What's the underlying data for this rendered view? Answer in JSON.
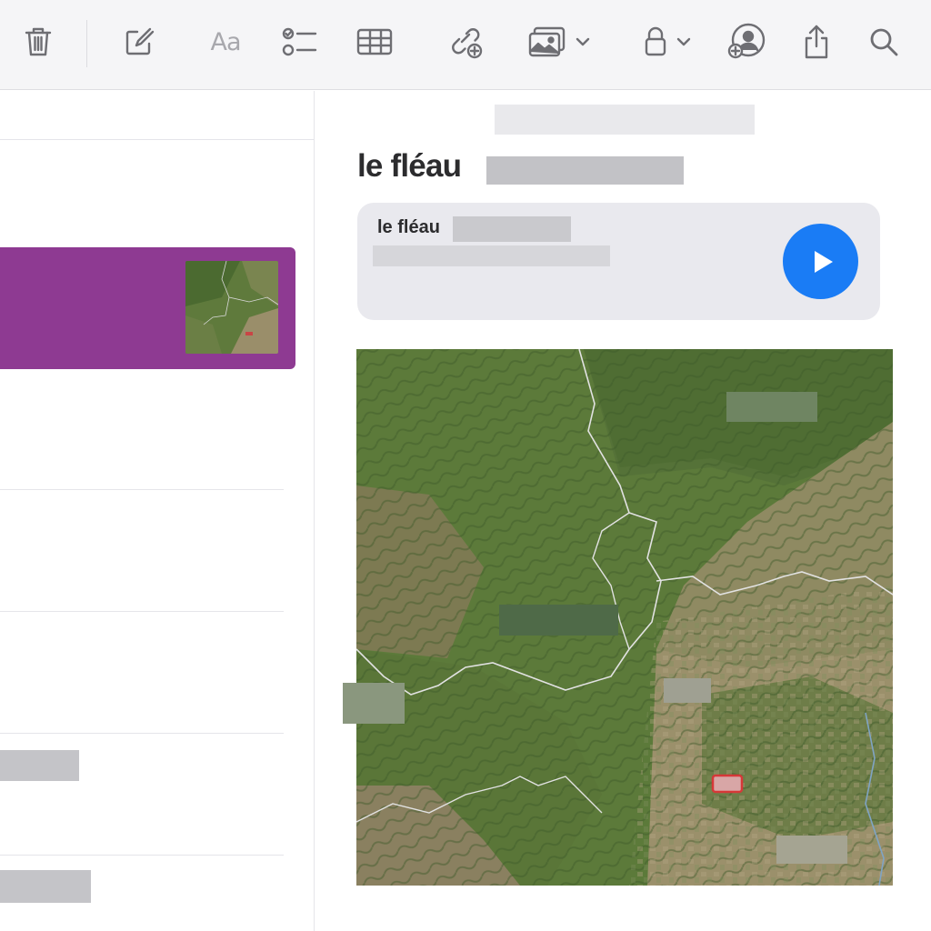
{
  "toolbar": {
    "buttons": [
      {
        "name": "delete",
        "icon": "trash-icon"
      },
      {
        "name": "new-note",
        "icon": "compose-icon"
      },
      {
        "name": "format",
        "icon": "text-format-icon",
        "label": "Aa"
      },
      {
        "name": "checklist",
        "icon": "checklist-icon"
      },
      {
        "name": "table",
        "icon": "table-icon"
      },
      {
        "name": "link",
        "icon": "link-add-icon"
      },
      {
        "name": "media",
        "icon": "photo-icon"
      },
      {
        "name": "lock",
        "icon": "lock-icon"
      },
      {
        "name": "collaborate",
        "icon": "person-add-icon"
      },
      {
        "name": "share",
        "icon": "share-icon"
      },
      {
        "name": "search",
        "icon": "search-icon"
      }
    ]
  },
  "note": {
    "title": "le fléau",
    "audio": {
      "label": "le fléau",
      "button_icon": "play-icon"
    }
  },
  "colors": {
    "selection": "#8e3a92",
    "accent": "#1a7cf5",
    "toolbar_bg": "#f5f5f7"
  }
}
